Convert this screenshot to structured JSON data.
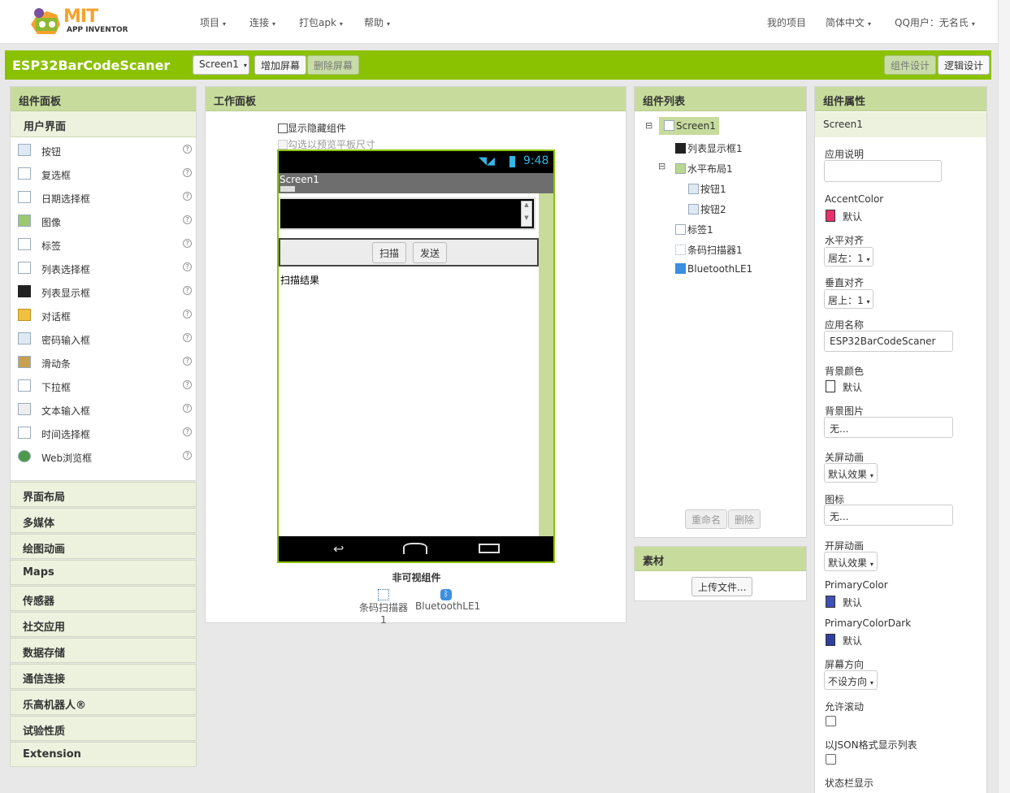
{
  "header": {
    "logo_text": "MIT",
    "logo_sub": "APP INVENTOR",
    "menu": [
      "项目",
      "连接",
      "打包apk",
      "帮助"
    ],
    "my_projects": "我的项目",
    "language": "简体中文",
    "user": "QQ用户：无名氏"
  },
  "toolbar": {
    "project_name": "ESP32BarCodeScaner",
    "screen_select": "Screen1",
    "add_screen": "增加屏幕",
    "remove_screen": "删除屏幕",
    "designer": "组件设计",
    "blocks": "逻辑设计"
  },
  "palette": {
    "title": "组件面板",
    "section": "用户界面",
    "items": [
      "按钮",
      "复选框",
      "日期选择框",
      "图像",
      "标签",
      "列表选择框",
      "列表显示框",
      "对话框",
      "密码输入框",
      "滑动条",
      "下拉框",
      "文本输入框",
      "时间选择框",
      "Web浏览框"
    ],
    "categories": [
      "界面布局",
      "多媒体",
      "绘图动画",
      "Maps",
      "传感器",
      "社交应用",
      "数据存储",
      "通信连接",
      "乐高机器人®",
      "试验性质",
      "Extension"
    ]
  },
  "viewer": {
    "title": "工作面板",
    "show_hidden": "显示隐藏组件",
    "tablet_preview": "勾选以预览平板尺寸",
    "status_time": "9:48",
    "screen_title": "Screen1",
    "scan_button": "扫描",
    "send_button": "发送",
    "result_label": "扫描结果",
    "nonvisible_title": "非可视组件",
    "nonvisible": [
      "条码扫描器1",
      "BluetoothLE1"
    ]
  },
  "components": {
    "title": "组件列表",
    "tree": [
      {
        "label": "Screen1",
        "level": 0,
        "expand": "⊟"
      },
      {
        "label": "列表显示框1",
        "level": 1
      },
      {
        "label": "水平布局1",
        "level": 1,
        "expand": "⊟"
      },
      {
        "label": "按钮1",
        "level": 2
      },
      {
        "label": "按钮2",
        "level": 2
      },
      {
        "label": "标签1",
        "level": 1
      },
      {
        "label": "条码扫描器1",
        "level": 1
      },
      {
        "label": "BluetoothLE1",
        "level": 1
      }
    ],
    "rename": "重命名",
    "delete": "删除"
  },
  "media": {
    "title": "素材",
    "upload": "上传文件..."
  },
  "properties": {
    "title": "组件属性",
    "component": "Screen1",
    "app_desc_label": "应用说明",
    "accent_label": "AccentColor",
    "accent_value": "默认",
    "accent_color": "#e8306a",
    "halign_label": "水平对齐",
    "halign_value": "居左：1",
    "valign_label": "垂直对齐",
    "valign_value": "居上：1",
    "appname_label": "应用名称",
    "appname_value": "ESP32BarCodeScaner",
    "bgcolor_label": "背景颜色",
    "bgcolor_value": "默认",
    "bgcolor_color": "#ffffff",
    "bgimage_label": "背景图片",
    "bgimage_value": "无...",
    "closeanim_label": "关屏动画",
    "closeanim_value": "默认效果",
    "icon_label": "图标",
    "icon_value": "无...",
    "openanim_label": "开屏动画",
    "openanim_value": "默认效果",
    "primary_label": "PrimaryColor",
    "primary_value": "默认",
    "primary_color": "#3f51b5",
    "primarydark_label": "PrimaryColorDark",
    "primarydark_value": "默认",
    "primarydark_color": "#303f9f",
    "orientation_label": "屏幕方向",
    "orientation_value": "不设方向",
    "scroll_label": "允许滚动",
    "json_label": "以JSON格式显示列表",
    "statusbar_label": "状态栏显示"
  },
  "colors": {
    "accent_green": "#8ac100",
    "panel_header": "#c7dc9c"
  }
}
